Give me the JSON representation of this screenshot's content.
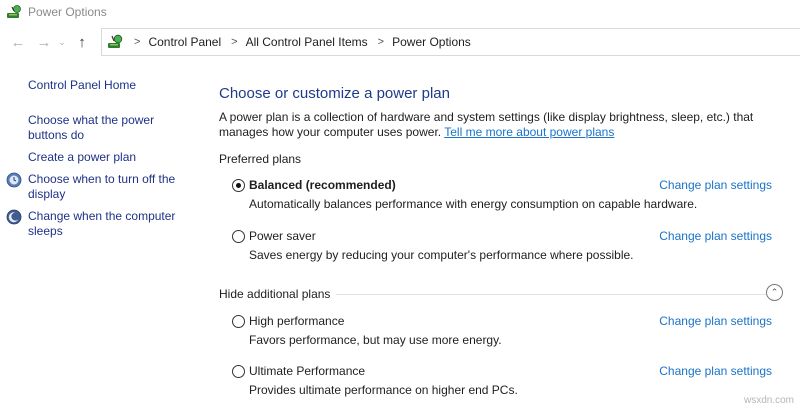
{
  "window": {
    "title": "Power Options",
    "app_icon": "power-options-icon"
  },
  "nav": {
    "back_icon": "arrow-left-icon",
    "forward_icon": "arrow-right-icon",
    "recent_icon": "chevron-down-icon",
    "up_icon": "arrow-up-icon"
  },
  "breadcrumb": {
    "items": [
      "Control Panel",
      "All Control Panel Items",
      "Power Options"
    ]
  },
  "sidebar": {
    "home": "Control Panel Home",
    "links": [
      {
        "label_line1": "Choose what the power",
        "label_line2": "buttons do",
        "icon": ""
      },
      {
        "label_line1": "Create a power plan",
        "label_line2": "",
        "icon": ""
      },
      {
        "label_line1": "Choose when to turn off the",
        "label_line2": "display",
        "icon": "display-icon"
      },
      {
        "label_line1": "Change when the computer",
        "label_line2": "sleeps",
        "icon": "moon-icon"
      }
    ]
  },
  "main": {
    "heading": "Choose or customize a power plan",
    "description": "A power plan is a collection of hardware and system settings (like display brightness, sleep, etc.) that manages how your computer uses power.",
    "learn_more": "Tell me more about power plans",
    "preferred_label": "Preferred plans",
    "additional_label": "Hide additional plans",
    "change_label": "Change plan settings",
    "preferred_plans": [
      {
        "name": "Balanced (recommended)",
        "desc": "Automatically balances performance with energy consumption on capable hardware.",
        "selected": true
      },
      {
        "name": "Power saver",
        "desc": "Saves energy by reducing your computer's performance where possible.",
        "selected": false
      }
    ],
    "additional_plans": [
      {
        "name": "High performance",
        "desc": "Favors performance, but may use more energy.",
        "selected": false
      },
      {
        "name": "Ultimate Performance",
        "desc": "Provides ultimate performance on higher end PCs.",
        "selected": false
      }
    ]
  },
  "watermark": "wsxdn.com",
  "colors": {
    "link": "#1a73c8",
    "nav_link": "#1e3287",
    "heading": "#1e3b8a"
  }
}
